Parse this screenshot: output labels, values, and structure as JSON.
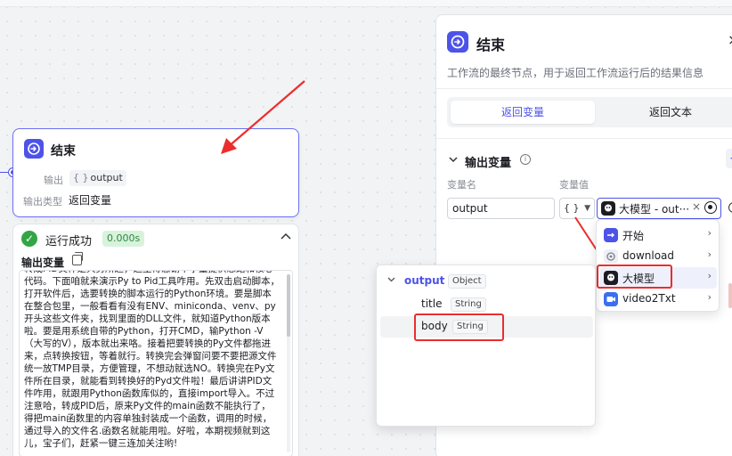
{
  "end_node": {
    "title": "结束",
    "output_label": "输出",
    "output_brace": "{ }",
    "output_value": "output",
    "output_type_label": "输出类型",
    "output_type_value": "返回变量"
  },
  "run_result": {
    "status": "运行成功",
    "duration": "0.000s",
    "output_var_label": "输出变量",
    "output_text": "转成PID文件是大势所趋，这里得感谢千字童提供思路和核心代码。下面咱就来演示Py to Pid工具咋用。先双击启动脚本，打开软件后，选要转换的脚本运行的Python环境。要是脚本在整合包里，一般看看有没有ENV、miniconda、venv、py开头这些文件夹，找到里面的DLL文件，就知道Python版本啦。要是用系统自带的Python，打开CMD，输Python -V（大写的V），版本就出来咯。接着把要转换的Py文件都拖进来，点转换按钮，等着就行。转换完会弹窗问要不要把源文件统一放TMP目录，方便管理，不想动就选NO。转换完在Py文件所在目录，就能看到转换好的Pyd文件啦！最后讲讲PID文件咋用，就跟用Python函数库似的，直接import导入。不过注意哈，转成PID后，原来Py文件的main函数不能执行了，得把main函数里的内容单独封装成一个函数，调用的时候，通过导入的文件名.函数名就能用啦。好啦，本期视频就到这儿，宝子们，赶紧一键三连加关注哟!"
  },
  "panel": {
    "title": "结束",
    "close": "×",
    "description": "工作流的最终节点，用于返回工作流运行后的结果信息",
    "tabs": [
      {
        "label": "返回变量",
        "active": true
      },
      {
        "label": "返回文本",
        "active": false
      }
    ],
    "section_title": "输出变量",
    "add_symbol": "+",
    "col_name": "变量名",
    "col_value": "变量值",
    "var_name": "output",
    "var_type": "{ }",
    "ref_text": "大模型 - out···",
    "ref_clear": "×"
  },
  "node_menu": {
    "items": [
      {
        "label": "开始",
        "icon": "start-icon",
        "color": "#4d53e8"
      },
      {
        "label": "download",
        "icon": "plugin-icon",
        "color": "#e8eaf3"
      },
      {
        "label": "大模型",
        "icon": "llm-icon",
        "color": "#1c1d23"
      },
      {
        "label": "video2Txt",
        "icon": "video-icon",
        "color": "#3a6ff0"
      }
    ]
  },
  "field_menu": {
    "root": {
      "name": "output",
      "type": "Object"
    },
    "children": [
      {
        "name": "title",
        "type": "String"
      },
      {
        "name": "body",
        "type": "String"
      }
    ]
  },
  "colors": {
    "accent": "#4d53e8",
    "success": "#32a645",
    "annotation_red": "#ec2d2d"
  }
}
